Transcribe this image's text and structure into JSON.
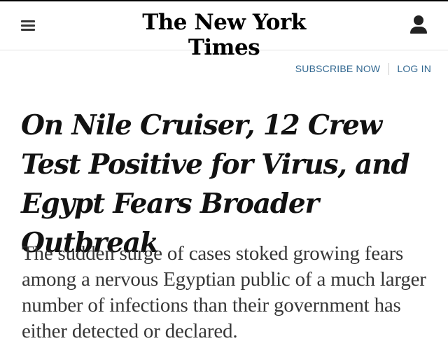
{
  "header": {
    "logo_text": "The New York Times",
    "menu_icon": "hamburger-menu-icon",
    "account_icon": "user-account-icon"
  },
  "auth": {
    "subscribe_label": "SUBSCRIBE NOW",
    "login_label": "LOG IN"
  },
  "article": {
    "headline": "On Nile Cruiser, 12 Crew Test Positive for Virus, and Egypt Fears Broader Outbreak",
    "summary": "The sudden surge of cases stoked growing fears among a nervous Egyptian public of a much larger number of infections than their government has either detected or declared."
  },
  "colors": {
    "link_blue": "#326891",
    "text": "#121212",
    "summary_text": "#363636"
  }
}
